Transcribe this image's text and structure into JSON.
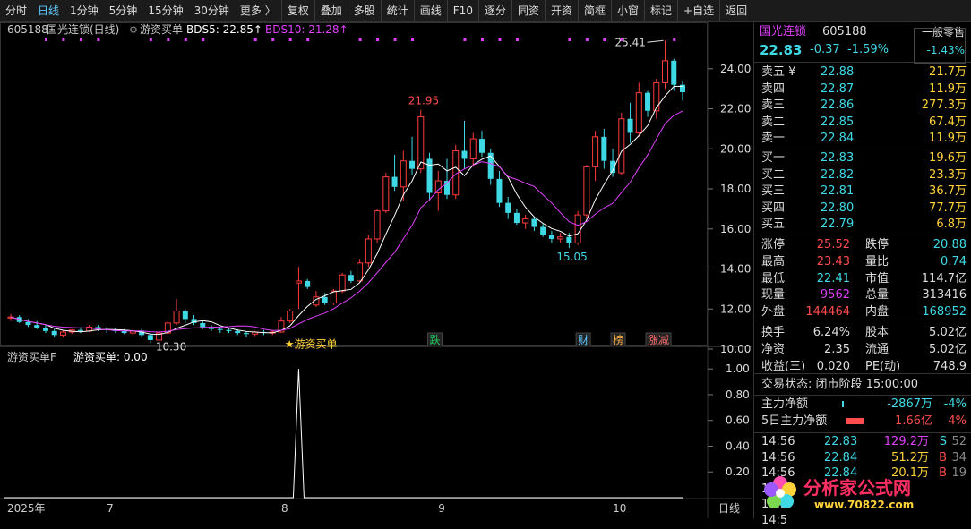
{
  "toolbar": {
    "items": [
      "分时",
      "日线",
      "1分钟",
      "5分钟",
      "15分钟",
      "30分钟",
      "更多 〉",
      "复权",
      "叠加",
      "多股",
      "统计",
      "画线",
      "F10",
      "逐分",
      "同资",
      "开资",
      "简框",
      "小窗",
      "标记",
      "+自选",
      "返回"
    ],
    "active": "日线"
  },
  "chart": {
    "header_code": "605188",
    "header_name": "国光连锁(日线)",
    "indicator_name": "游资买单",
    "bds5_label": "BDS5: 22.85↑",
    "bds10_label": "BDS10: 21.28↑",
    "high_label": "21.95",
    "low_label": "15.05",
    "top_label": "25.41",
    "bottom_label": "10.30",
    "buy_signal_label": "★游资买单",
    "event_tags": [
      "跌",
      "财",
      "榜",
      "涨减"
    ],
    "price_ticks": [
      "24.00",
      "22.00",
      "20.00",
      "18.00",
      "16.00",
      "14.00",
      "12.00",
      "10.00"
    ],
    "sub_header": "游资买单F",
    "sub_value": "游资买单: 0.00",
    "sub_ticks": [
      "1.00",
      "0.80",
      "0.60",
      "0.40",
      "0.20"
    ],
    "x_labels": [
      "2025年",
      "7",
      "8",
      "9",
      "10"
    ],
    "period_label": "日线",
    "colors": {
      "up": "#ff3b3b",
      "down": "#3fd9e6",
      "ma5": "#ffffff",
      "ma10": "#e040fb"
    }
  },
  "chart_data": {
    "type": "candlestick",
    "ohlc_approx": [
      [
        11.55,
        11.75,
        11.4,
        11.6
      ],
      [
        11.6,
        11.7,
        11.3,
        11.35
      ],
      [
        11.35,
        11.5,
        11.1,
        11.2
      ],
      [
        11.2,
        11.4,
        11.0,
        11.05
      ],
      [
        11.05,
        11.2,
        10.8,
        10.9
      ],
      [
        10.9,
        11.0,
        10.6,
        10.7
      ],
      [
        10.7,
        10.95,
        10.6,
        10.85
      ],
      [
        10.85,
        11.0,
        10.75,
        10.95
      ],
      [
        10.95,
        11.1,
        10.8,
        10.9
      ],
      [
        10.9,
        11.2,
        10.85,
        11.1
      ],
      [
        11.1,
        11.2,
        10.9,
        11.0
      ],
      [
        11.0,
        11.1,
        10.8,
        10.95
      ],
      [
        10.95,
        11.05,
        10.8,
        10.9
      ],
      [
        10.9,
        11.0,
        10.75,
        10.8
      ],
      [
        10.8,
        11.0,
        10.7,
        10.9
      ],
      [
        10.9,
        11.0,
        10.6,
        10.7
      ],
      [
        10.7,
        10.8,
        10.3,
        10.45
      ],
      [
        10.45,
        10.9,
        10.4,
        10.8
      ],
      [
        10.8,
        11.4,
        10.7,
        11.3
      ],
      [
        11.3,
        12.5,
        11.2,
        11.9
      ],
      [
        11.9,
        12.0,
        11.3,
        11.5
      ],
      [
        11.5,
        11.7,
        11.2,
        11.3
      ],
      [
        11.3,
        11.4,
        11.0,
        11.1
      ],
      [
        11.1,
        11.2,
        10.9,
        11.0
      ],
      [
        11.0,
        11.1,
        10.8,
        10.95
      ],
      [
        10.95,
        11.05,
        10.8,
        10.9
      ],
      [
        10.9,
        11.0,
        10.7,
        10.8
      ],
      [
        10.8,
        10.9,
        10.6,
        10.75
      ],
      [
        10.75,
        10.9,
        10.65,
        10.85
      ],
      [
        10.85,
        10.95,
        10.7,
        10.8
      ],
      [
        10.8,
        10.95,
        10.7,
        10.85
      ],
      [
        10.85,
        11.6,
        10.8,
        11.4
      ],
      [
        11.4,
        12.0,
        11.3,
        11.9
      ],
      [
        13.3,
        14.1,
        12.0,
        13.4
      ],
      [
        13.4,
        13.5,
        13.0,
        13.1
      ],
      [
        12.2,
        12.9,
        12.1,
        12.6
      ],
      [
        12.6,
        12.8,
        12.2,
        12.3
      ],
      [
        12.3,
        13.0,
        12.2,
        12.9
      ],
      [
        12.9,
        13.8,
        12.8,
        13.7
      ],
      [
        13.7,
        13.9,
        13.3,
        13.4
      ],
      [
        13.4,
        14.5,
        13.3,
        14.3
      ],
      [
        14.3,
        15.7,
        14.1,
        15.5
      ],
      [
        15.5,
        17.0,
        15.3,
        16.9
      ],
      [
        16.9,
        18.8,
        16.8,
        18.6
      ],
      [
        18.6,
        19.7,
        17.9,
        18.1
      ],
      [
        18.1,
        19.9,
        17.4,
        19.4
      ],
      [
        19.4,
        20.6,
        18.7,
        19.0
      ],
      [
        19.0,
        21.95,
        18.8,
        21.6
      ],
      [
        19.5,
        19.8,
        17.4,
        17.8
      ],
      [
        17.8,
        18.9,
        16.9,
        18.4
      ],
      [
        18.4,
        19.5,
        17.5,
        17.7
      ],
      [
        17.7,
        20.2,
        17.5,
        19.9
      ],
      [
        19.9,
        21.4,
        19.0,
        19.5
      ],
      [
        19.5,
        20.8,
        19.1,
        20.5
      ],
      [
        20.5,
        20.9,
        19.6,
        19.8
      ],
      [
        19.8,
        20.0,
        18.2,
        18.5
      ],
      [
        18.5,
        18.9,
        17.1,
        17.3
      ],
      [
        17.3,
        17.6,
        16.5,
        16.8
      ],
      [
        16.8,
        17.0,
        16.2,
        16.3
      ],
      [
        16.3,
        16.7,
        16.0,
        16.5
      ],
      [
        16.5,
        16.6,
        15.9,
        16.1
      ],
      [
        16.1,
        16.3,
        15.6,
        15.7
      ],
      [
        15.7,
        15.9,
        15.3,
        15.5
      ],
      [
        15.5,
        15.8,
        15.3,
        15.6
      ],
      [
        15.6,
        15.8,
        15.05,
        15.3
      ],
      [
        15.3,
        16.9,
        15.2,
        16.7
      ],
      [
        16.7,
        19.2,
        16.5,
        19.1
      ],
      [
        19.1,
        20.9,
        18.4,
        20.6
      ],
      [
        20.6,
        21.0,
        19.0,
        19.4
      ],
      [
        19.4,
        20.0,
        18.6,
        18.8
      ],
      [
        18.8,
        21.8,
        18.7,
        21.5
      ],
      [
        21.5,
        22.3,
        20.3,
        20.8
      ],
      [
        20.8,
        23.3,
        20.6,
        22.8
      ],
      [
        22.8,
        22.9,
        21.6,
        21.9
      ],
      [
        21.9,
        23.5,
        21.5,
        23.3
      ],
      [
        23.3,
        25.41,
        23.0,
        24.4
      ],
      [
        24.4,
        24.5,
        22.9,
        23.2
      ],
      [
        23.2,
        23.4,
        22.41,
        22.83
      ]
    ],
    "series": [
      {
        "name": "BDS5",
        "last": 22.85
      },
      {
        "name": "BDS10",
        "last": 21.28
      }
    ],
    "ylim": [
      10,
      25.6
    ],
    "subchart": {
      "name": "游资买单F",
      "peak_value": 1.0,
      "ylim": [
        0,
        1.05
      ]
    }
  },
  "quote": {
    "name": "国光连锁",
    "code": "605188",
    "mode": "一般零售",
    "price": "22.83",
    "change": "-0.37",
    "change_pct": "-1.59%",
    "sector_pct": "-1.43%",
    "asks": [
      {
        "label": "卖五 ¥",
        "price": "22.88",
        "vol": "21.7万"
      },
      {
        "label": "卖四",
        "price": "22.87",
        "vol": "11.9万"
      },
      {
        "label": "卖三",
        "price": "22.86",
        "vol": "277.3万"
      },
      {
        "label": "卖二",
        "price": "22.85",
        "vol": "67.4万"
      },
      {
        "label": "卖一",
        "price": "22.84",
        "vol": "11.9万"
      }
    ],
    "bids": [
      {
        "label": "买一",
        "price": "22.83",
        "vol": "19.6万"
      },
      {
        "label": "买二",
        "price": "22.82",
        "vol": "23.3万"
      },
      {
        "label": "买三",
        "price": "22.81",
        "vol": "36.7万"
      },
      {
        "label": "买四",
        "price": "22.80",
        "vol": "77.7万"
      },
      {
        "label": "买五",
        "price": "22.79",
        "vol": "6.8万"
      }
    ],
    "stats": [
      {
        "l1": "涨停",
        "v1": "25.52",
        "c1": "#ff4d4d",
        "l2": "跌停",
        "v2": "20.88",
        "c2": "#3fd9e6"
      },
      {
        "l1": "最高",
        "v1": "23.43",
        "c1": "#ff4d4d",
        "l2": "量比",
        "v2": "0.74",
        "c2": "#3fd9e6"
      },
      {
        "l1": "最低",
        "v1": "22.41",
        "c1": "#3fd9e6",
        "l2": "市值",
        "v2": "114.7亿",
        "c2": "#ddd"
      },
      {
        "l1": "现量",
        "v1": "9562",
        "c1": "#e040fb",
        "l2": "总量",
        "v2": "313416",
        "c2": "#ddd"
      },
      {
        "l1": "外盘",
        "v1": "144464",
        "c1": "#ff4d4d",
        "l2": "内盘",
        "v2": "168952",
        "c2": "#3fd9e6"
      },
      {
        "l1": "换手",
        "v1": "6.24%",
        "c1": "#ddd",
        "l2": "股本",
        "v2": "5.02亿",
        "c2": "#ddd"
      },
      {
        "l1": "净资",
        "v1": "2.35",
        "c1": "#ddd",
        "l2": "流通",
        "v2": "5.02亿",
        "c2": "#ddd"
      },
      {
        "l1": "收益(三)",
        "v1": "0.020",
        "c1": "#ddd",
        "l2": "PE(动)",
        "v2": "748.9",
        "c2": "#ddd"
      }
    ],
    "status": "交易状态: 闭市阶段 15:00:00",
    "flows": [
      {
        "label": "主力净额",
        "value": "-2867万",
        "pct": "-4%",
        "color": "#3fd9e6"
      },
      {
        "label": "5日主力净额",
        "value": "1.66亿",
        "pct": "4%",
        "color": "#ff4d4d"
      }
    ],
    "ticks": [
      {
        "time": "14:56",
        "price": "22.83",
        "vol": "129.2万",
        "side": "S",
        "n": "52"
      },
      {
        "time": "14:56",
        "price": "22.84",
        "vol": "51.2万",
        "side": "B",
        "n": "34"
      },
      {
        "time": "14:56",
        "price": "22.84",
        "vol": "20.1万",
        "side": "B",
        "n": "19"
      },
      {
        "time": "14:56",
        "price": "",
        "vol": "",
        "side": "",
        "n": ""
      },
      {
        "time": "14:5",
        "price": "",
        "vol": "",
        "side": "",
        "n": ""
      },
      {
        "time": "14:5",
        "price": "",
        "vol": "",
        "side": "",
        "n": ""
      }
    ]
  },
  "watermark": {
    "text": "分析家公式网",
    "url": "www.70822.com"
  }
}
